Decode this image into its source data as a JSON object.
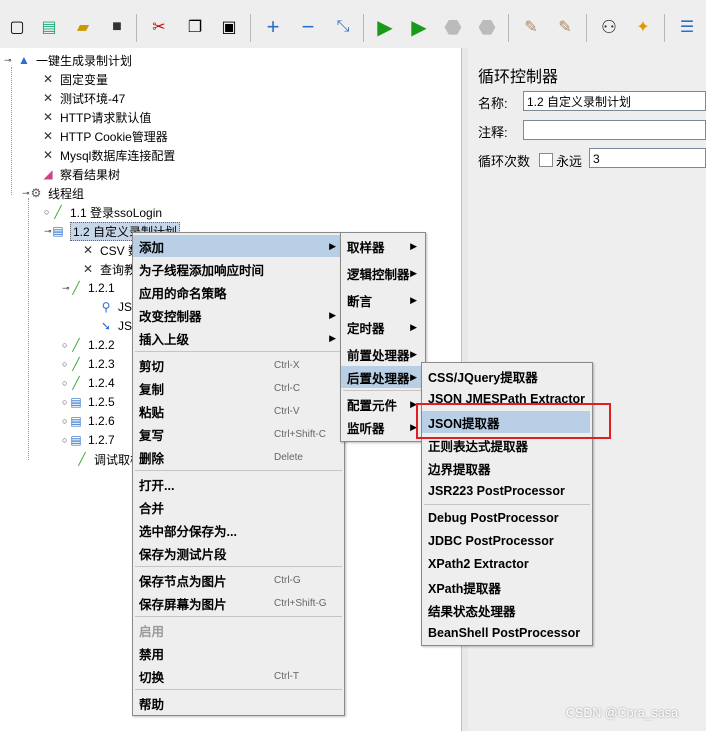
{
  "toolbar": {
    "icons": [
      "new-icon",
      "templates-icon",
      "open-icon",
      "save-icon",
      "cut-icon",
      "copy-icon",
      "paste-icon",
      "expand-icon",
      "collapse-icon",
      "toggle-icon",
      "start-icon",
      "start-no-pause-icon",
      "stop-icon",
      "shutdown-icon",
      "clear-icon",
      "clear-all-icon",
      "search-icon",
      "reset-search-icon",
      "function-helper-icon"
    ]
  },
  "tree": {
    "root": "一键生成录制计划",
    "items": [
      {
        "label": "固定变量"
      },
      {
        "label": "测试环境-47"
      },
      {
        "label": "HTTP请求默认值"
      },
      {
        "label": "HTTP Cookie管理器"
      },
      {
        "label": "Mysql数据库连接配置"
      },
      {
        "label": "察看结果树"
      },
      {
        "label": "线程组"
      },
      {
        "label": "1.1 登录ssoLogin"
      },
      {
        "label": "1.2 自定义录制计划"
      },
      {
        "label": "CSV 数"
      },
      {
        "label": "查询教"
      },
      {
        "label": "1.2.1"
      },
      {
        "label": "JS"
      },
      {
        "label": "JS"
      },
      {
        "label": "1.2.2"
      },
      {
        "label": "1.2.3"
      },
      {
        "label": "1.2.4"
      },
      {
        "label": "1.2.5"
      },
      {
        "label": "1.2.6"
      },
      {
        "label": "1.2.7"
      },
      {
        "label": "调试取样器"
      }
    ]
  },
  "panel": {
    "title": "循环控制器",
    "name_label": "名称:",
    "name_value": "1.2 自定义录制计划",
    "comment_label": "注释:",
    "comment_value": "",
    "loops_label": "循环次数",
    "forever_label": "永远",
    "loops_value": "3"
  },
  "context_menu": {
    "items": [
      {
        "label": "添加",
        "shortcut": ""
      },
      {
        "label": "为子线程添加响应时间",
        "shortcut": ""
      },
      {
        "label": "应用的命名策略",
        "shortcut": ""
      },
      {
        "label": "改变控制器",
        "shortcut": ""
      },
      {
        "label": "插入上级",
        "shortcut": ""
      },
      {
        "label": "剪切",
        "shortcut": "Ctrl-X"
      },
      {
        "label": "复制",
        "shortcut": "Ctrl-C"
      },
      {
        "label": "粘贴",
        "shortcut": "Ctrl-V"
      },
      {
        "label": "复写",
        "shortcut": "Ctrl+Shift-C"
      },
      {
        "label": "删除",
        "shortcut": "Delete"
      },
      {
        "label": "打开...",
        "shortcut": ""
      },
      {
        "label": "合并",
        "shortcut": ""
      },
      {
        "label": "选中部分保存为...",
        "shortcut": ""
      },
      {
        "label": "保存为测试片段",
        "shortcut": ""
      },
      {
        "label": "保存节点为图片",
        "shortcut": "Ctrl-G"
      },
      {
        "label": "保存屏幕为图片",
        "shortcut": "Ctrl+Shift-G"
      },
      {
        "label": "启用",
        "shortcut": ""
      },
      {
        "label": "禁用",
        "shortcut": ""
      },
      {
        "label": "切换",
        "shortcut": "Ctrl-T"
      },
      {
        "label": "帮助",
        "shortcut": ""
      }
    ]
  },
  "add_submenu": {
    "items": [
      "取样器",
      "逻辑控制器",
      "断言",
      "定时器",
      "前置处理器",
      "后置处理器",
      "配置元件",
      "监听器"
    ]
  },
  "post_processor_submenu": {
    "items": [
      "CSS/JQuery提取器",
      "JSON JMESPath Extractor",
      "JSON提取器",
      "正则表达式提取器",
      "边界提取器",
      "JSR223 PostProcessor",
      "Debug PostProcessor",
      "JDBC PostProcessor",
      "XPath2 Extractor",
      "XPath提取器",
      "结果状态处理器",
      "BeanShell PostProcessor"
    ]
  },
  "watermark": "CSDN @Cora_sasa",
  "colors": {
    "highlight": "#b8cfe5",
    "annotation": "#e02020",
    "selection": "#c7d6e8"
  }
}
